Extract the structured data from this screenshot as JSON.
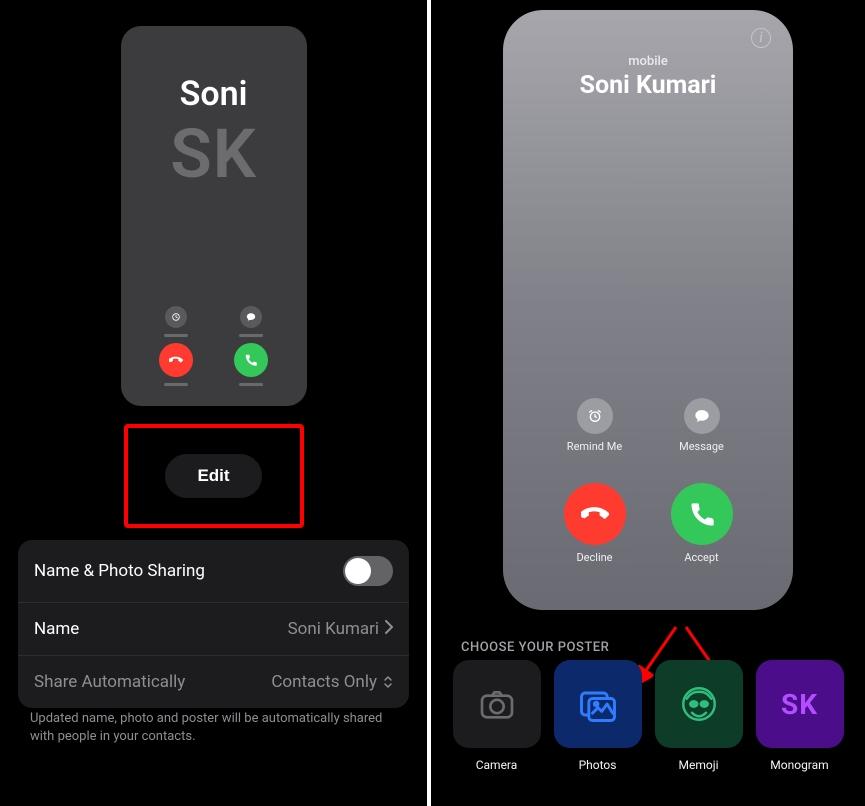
{
  "left": {
    "poster": {
      "name": "Soni",
      "initials": "SK"
    },
    "editLabel": "Edit",
    "settings": {
      "sharingLabel": "Name & Photo Sharing",
      "sharingEnabled": false,
      "nameLabel": "Name",
      "nameValue": "Soni Kumari",
      "autoLabel": "Share Automatically",
      "autoValue": "Contacts Only"
    },
    "footnote": "Updated name, photo and poster will be automatically shared with people in your contacts."
  },
  "right": {
    "callerType": "mobile",
    "callerName": "Soni Kumari",
    "actions": {
      "remind": "Remind Me",
      "message": "Message",
      "decline": "Decline",
      "accept": "Accept"
    },
    "chooseLabel": "CHOOSE YOUR POSTER",
    "options": {
      "camera": "Camera",
      "photos": "Photos",
      "memoji": "Memoji",
      "monogram": "Monogram",
      "monogramText": "SK"
    }
  }
}
